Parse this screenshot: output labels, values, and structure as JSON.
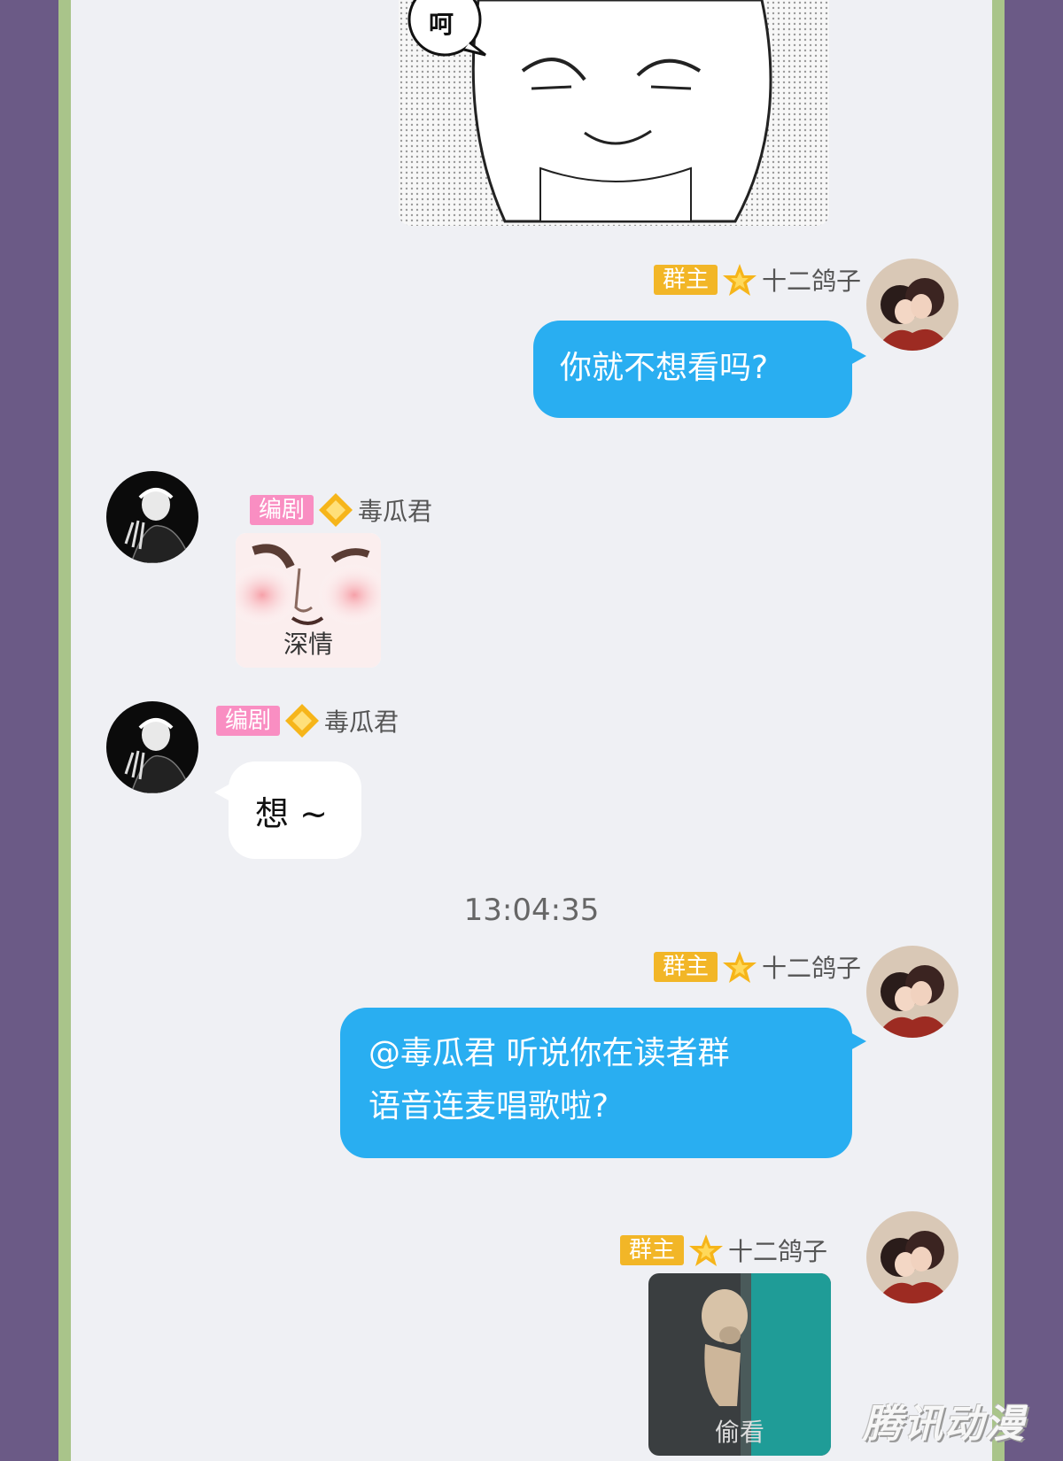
{
  "manga_panel": {
    "speech_text": "呵"
  },
  "roles": {
    "owner": "群主",
    "writer": "编剧"
  },
  "users": {
    "owner": "十二鸽子",
    "writer": "毒瓜君"
  },
  "messages": [
    {
      "sender": "十二鸽子",
      "role": "群主",
      "text": "你就不想看吗?"
    },
    {
      "sender": "毒瓜君",
      "role": "编剧",
      "sticker_caption": "深情"
    },
    {
      "sender": "毒瓜君",
      "role": "编剧",
      "text": "想 ~"
    },
    {
      "sender": "十二鸽子",
      "role": "群主",
      "text_line1": "@毒瓜君 听说你在读者群",
      "text_line2": "语音连麦唱歌啦?"
    },
    {
      "sender": "十二鸽子",
      "role": "群主",
      "sticker_caption": "偷看"
    }
  ],
  "timestamp": "13:04:35",
  "watermark": "腾讯动漫",
  "colors": {
    "background_outer": "#6b5a86",
    "frame": "#a9c48a",
    "chat_bg": "#eff0f4",
    "my_bubble": "#29aef1",
    "owner_badge": "#f2b627",
    "writer_badge": "#f98ec2"
  },
  "icons": [
    "star-rank-icon",
    "diamond-rank-icon"
  ]
}
